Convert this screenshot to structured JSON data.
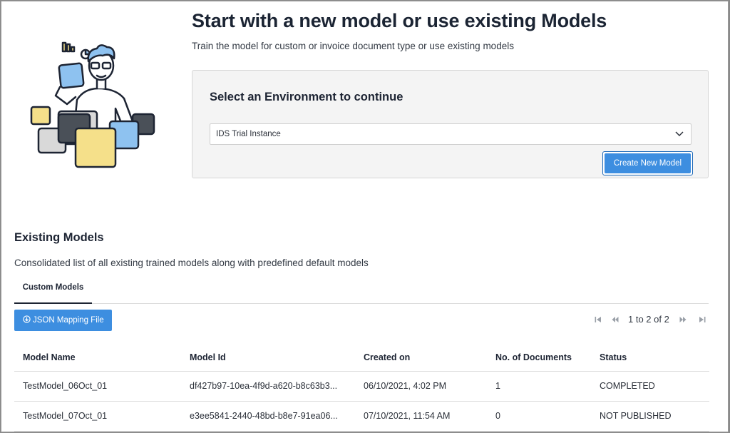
{
  "colors": {
    "accent": "#3d8ee0",
    "accent_border": "#1e69b8",
    "text": "#1d2433"
  },
  "hero": {
    "title": "Start with a new model or use existing Models",
    "subtitle": "Train the model for custom or invoice document type or use existing models"
  },
  "environment": {
    "title": "Select an Environment to continue",
    "selected": "IDS Trial Instance",
    "create_button": "Create New Model"
  },
  "existing": {
    "title": "Existing Models",
    "subtitle": "Consolidated list of all existing trained models along with predefined default models",
    "tabs": [
      {
        "label": "Custom Models",
        "active": true
      }
    ],
    "json_button": "JSON Mapping File",
    "pager": {
      "text": "1 to 2 of 2",
      "icons": [
        "first-page-icon",
        "prev-page-icon",
        "next-page-icon",
        "last-page-icon"
      ]
    },
    "columns": [
      "Model Name",
      "Model Id",
      "Created on",
      "No. of Documents",
      "Status"
    ],
    "rows": [
      [
        "TestModel_06Oct_01",
        "df427b97-10ea-4f9d-a620-b8c63b3...",
        "06/10/2021, 4:02 PM",
        "1",
        "COMPLETED"
      ],
      [
        "TestModel_07Oct_01",
        "e3ee5841-2440-48bd-b8e7-91ea06...",
        "07/10/2021, 11:54 AM",
        "0",
        "NOT PUBLISHED"
      ]
    ]
  }
}
